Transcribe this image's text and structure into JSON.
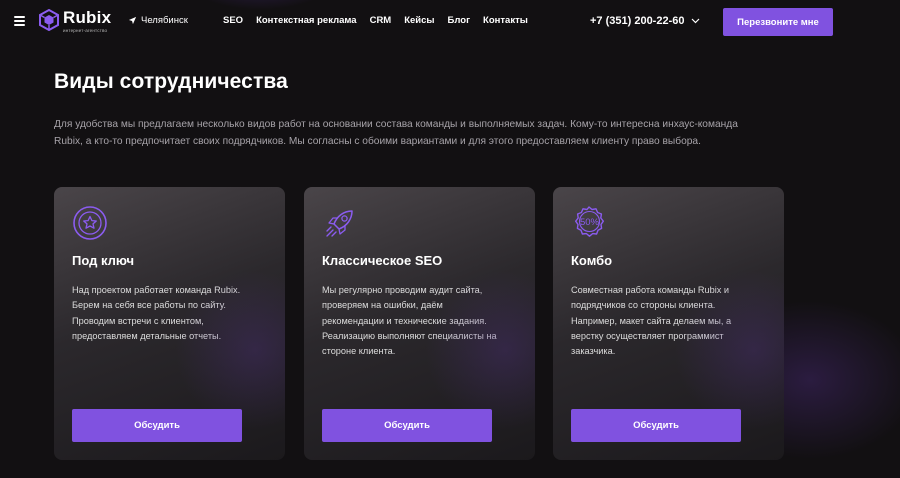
{
  "header": {
    "logo_name": "Rubix",
    "logo_sub": "интернет-агентство",
    "city": "Челябинск",
    "nav": [
      "SEO",
      "Контекстная реклама",
      "CRM",
      "Кейсы",
      "Блог",
      "Контакты"
    ],
    "phone": "+7 (351) 200-22-60",
    "callback_label": "Перезвоните мне"
  },
  "section": {
    "title": "Виды сотрудничества",
    "lead": "Для удобства мы предлагаем несколько видов работ на основании состава команды и выполняемых задач. Кому-то интересна инхаус-команда Rubix, а кто-то предпочитает своих подрядчиков. Мы согласны с обоими вариантами и для этого предоставляем клиенту право выбора."
  },
  "cards": [
    {
      "icon": "star-badge-icon",
      "title": "Под ключ",
      "text": "Над проектом работает команда Rubix. Берем на себя все работы по сайту. Проводим встречи с клиентом, предоставляем детальные отчеты.",
      "button": "Обсудить"
    },
    {
      "icon": "rocket-icon",
      "title": "Классическое SEO",
      "text": "Мы регулярно проводим аудит сайта, проверяем на ошибки, даём рекомендации и технические задания. Реализацию выполняют специалисты на стороне клиента.",
      "button": "Обсудить"
    },
    {
      "icon": "percent-badge-icon",
      "badge_text": "50%",
      "title": "Комбо",
      "text": "Совместная работа команды Rubix и подрядчиков со стороны клиента. Например, макет сайта делаем мы, а верстку осуществляет программист заказчика.",
      "button": "Обсудить"
    }
  ],
  "colors": {
    "background": "#121012",
    "accent": "#8052e0",
    "icon": "#8b5cf0"
  }
}
